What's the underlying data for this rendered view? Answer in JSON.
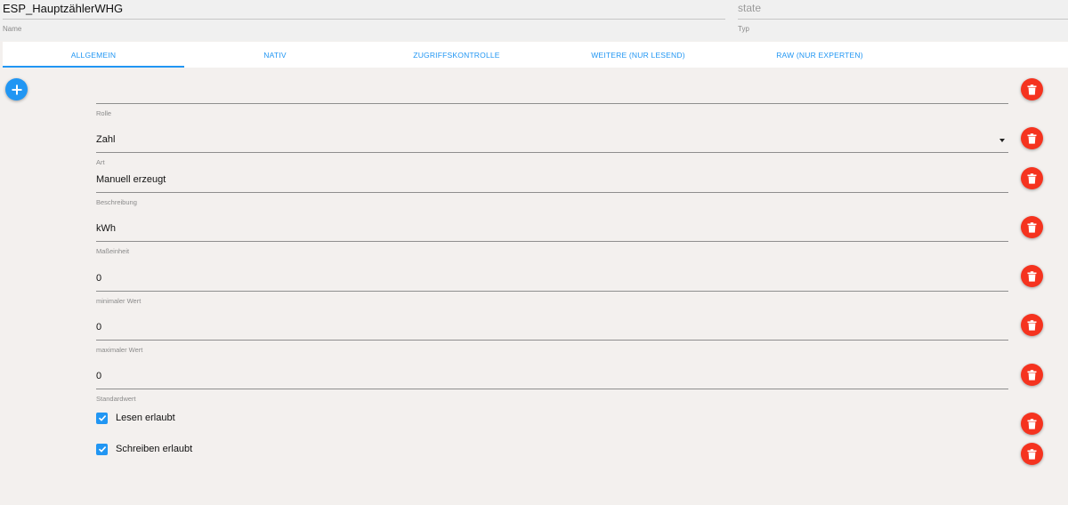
{
  "header": {
    "name_value": "ESP_HauptzählerWHG",
    "name_label": "Name",
    "type_placeholder": "state",
    "type_label": "Typ"
  },
  "tabs": [
    {
      "label": "ALLGEMEIN",
      "active": true
    },
    {
      "label": "NATIV",
      "active": false
    },
    {
      "label": "ZUGRIFFSKONTROLLE",
      "active": false
    },
    {
      "label": "WEITERE (NUR LESEND)",
      "active": false
    },
    {
      "label": "RAW (NUR EXPERTEN)",
      "active": false
    }
  ],
  "fields": {
    "role": {
      "value": "",
      "label": "Rolle"
    },
    "type": {
      "value": "Zahl",
      "label": "Art"
    },
    "description": {
      "value": "Manuell erzeugt",
      "label": "Beschreibung"
    },
    "unit": {
      "value": "kWh",
      "label": "Maßeinheit"
    },
    "min": {
      "value": "0",
      "label": "minimaler Wert"
    },
    "max": {
      "value": "0",
      "label": "maximaler Wert"
    },
    "default": {
      "value": "0",
      "label": "Standardwert"
    }
  },
  "checkboxes": {
    "read": {
      "label": "Lesen erlaubt",
      "checked": true
    },
    "write": {
      "label": "Schreiben erlaubt",
      "checked": true
    }
  },
  "icons": {
    "add": "plus-icon",
    "delete": "trash-icon",
    "dropdown": "caret-down-icon",
    "check": "check-icon"
  },
  "colors": {
    "accent": "#2196f3",
    "danger": "#f5331f",
    "background": "#f3f0ee"
  }
}
